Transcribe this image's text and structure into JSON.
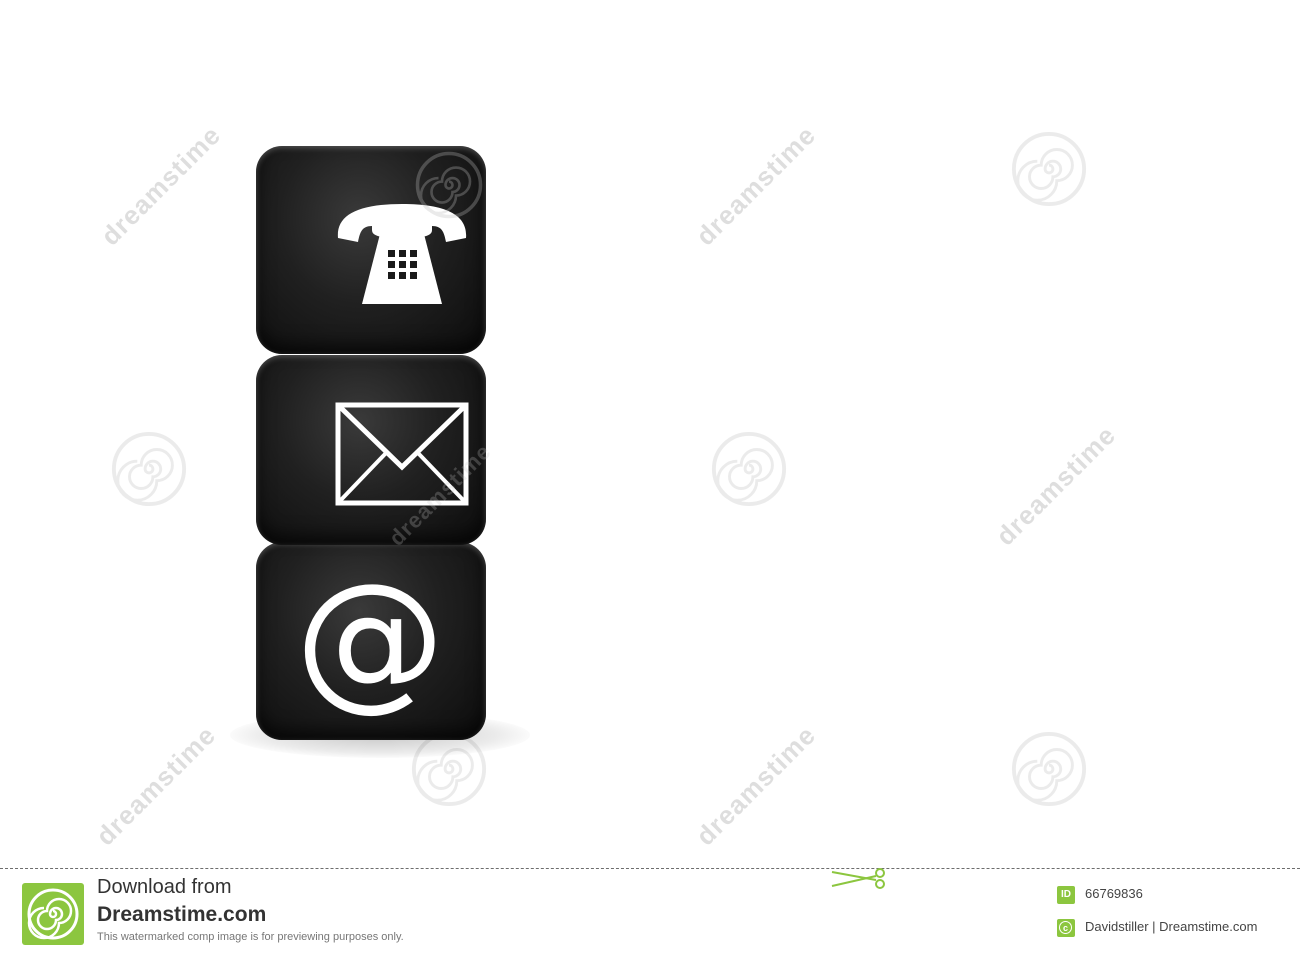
{
  "icons": {
    "top_cube": "telephone-icon",
    "middle_cube": "envelope-icon",
    "bottom_cube": "at-sign-icon"
  },
  "watermark": {
    "text": "dreamstime"
  },
  "footer": {
    "download_line": "Download from",
    "brand": "Dreamstime.com",
    "disclaimer": "This watermarked comp image is for previewing purposes only.",
    "id_badge": "ID",
    "image_id": "66769836",
    "credit": "Davidstiller | Dreamstime.com"
  },
  "colors": {
    "cube": "#1a1a1a",
    "brand_green": "#8cc63f",
    "icon": "#ffffff"
  }
}
